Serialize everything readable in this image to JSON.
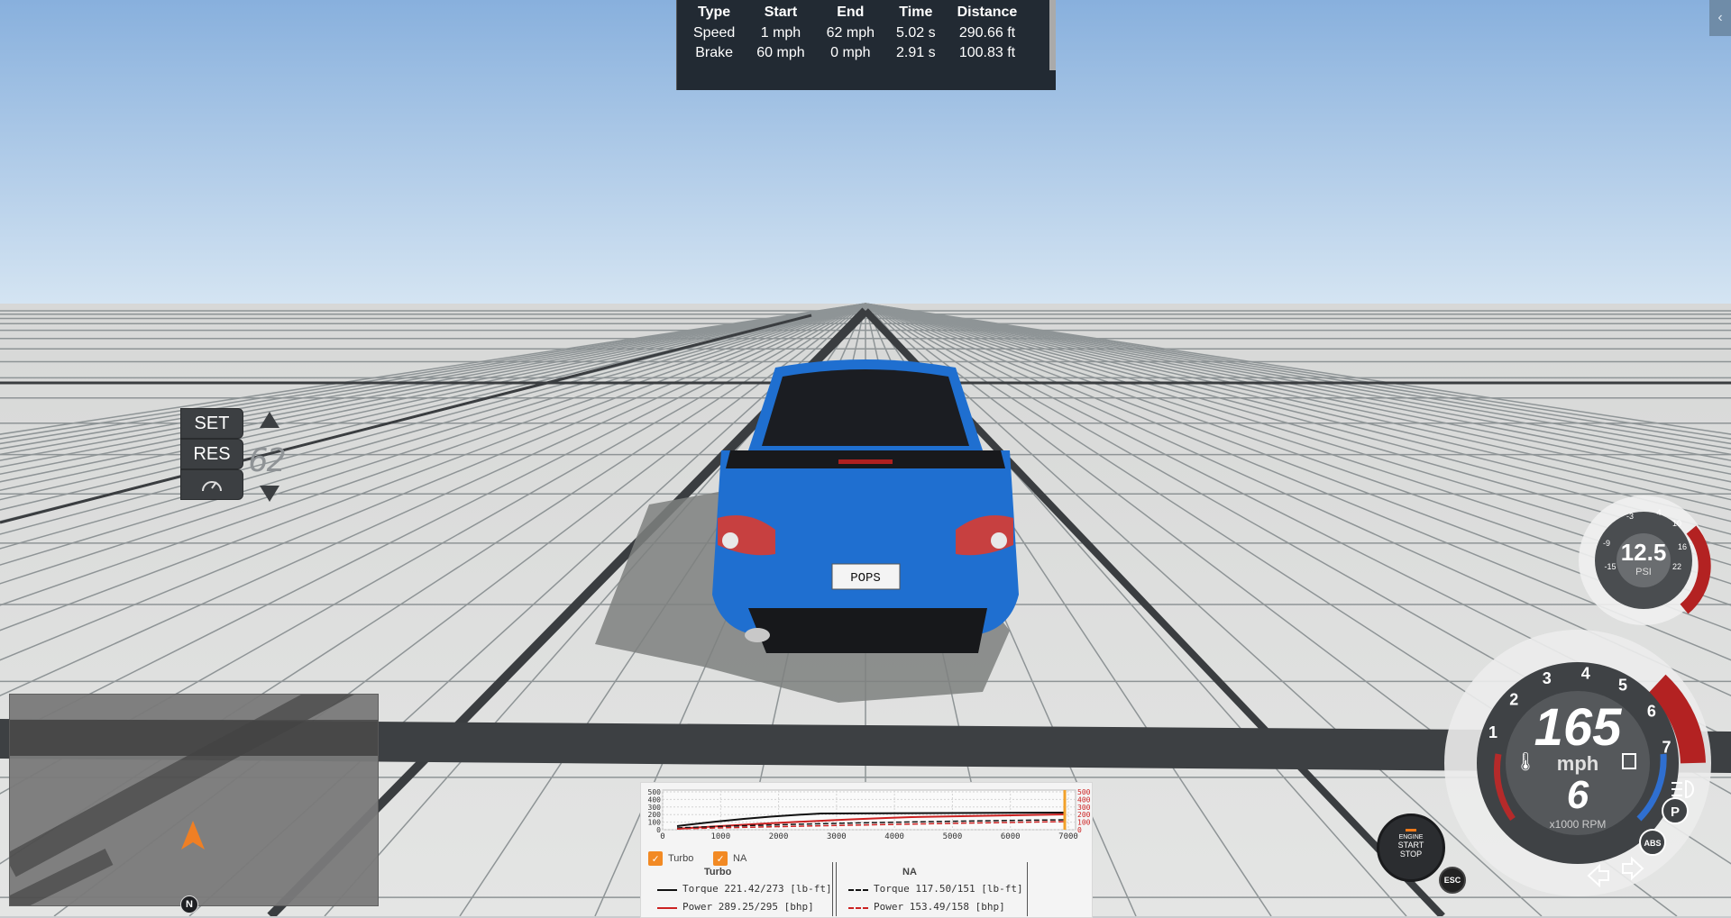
{
  "stats": {
    "headers": [
      "Type",
      "Start",
      "End",
      "Time",
      "Distance"
    ],
    "rows": [
      [
        "Speed",
        "1 mph",
        "62 mph",
        "5.02 s",
        "290.66 ft"
      ],
      [
        "Brake",
        "60 mph",
        "0 mph",
        "2.91 s",
        "100.83 ft"
      ]
    ]
  },
  "side_tab_icon": "chevron-left-icon",
  "cruise": {
    "set_label": "SET",
    "res_label": "RES",
    "speed": "62"
  },
  "vehicle": {
    "plate": "POPS",
    "color": "#1f6fd0"
  },
  "torque_graph": {
    "y_ticks": [
      "500",
      "400",
      "300",
      "200",
      "100",
      "0"
    ],
    "x_ticks": [
      "0",
      "1000",
      "2000",
      "3000",
      "4000",
      "5000",
      "6000",
      "7000"
    ],
    "checkbox_turbo": "Turbo",
    "checkbox_na": "NA",
    "col_turbo_title": "Turbo",
    "col_na_title": "NA",
    "turbo_torque": "Torque 221.42/273 [lb-ft]",
    "turbo_power": "Power  289.25/295 [bhp]",
    "na_torque": "Torque 117.50/151 [lb-ft]",
    "na_power": "Power  153.49/158 [bhp]"
  },
  "boost_gauge": {
    "value": "12.5",
    "unit": "PSI",
    "ticks": [
      "-3",
      "4",
      "10",
      "-9",
      "16",
      "-15",
      "22"
    ]
  },
  "speedo": {
    "speed": "165",
    "unit": "mph",
    "gear": "6",
    "rpm_label": "x1000 RPM",
    "rpm_ticks": [
      "1",
      "2",
      "3",
      "4",
      "5",
      "6",
      "7"
    ],
    "park_label": "P",
    "abs_label": "ABS"
  },
  "engine_button": {
    "line1": "ENGINE",
    "line2": "START",
    "line3": "STOP"
  },
  "esc_label": "ESC",
  "compass_label": "N"
}
